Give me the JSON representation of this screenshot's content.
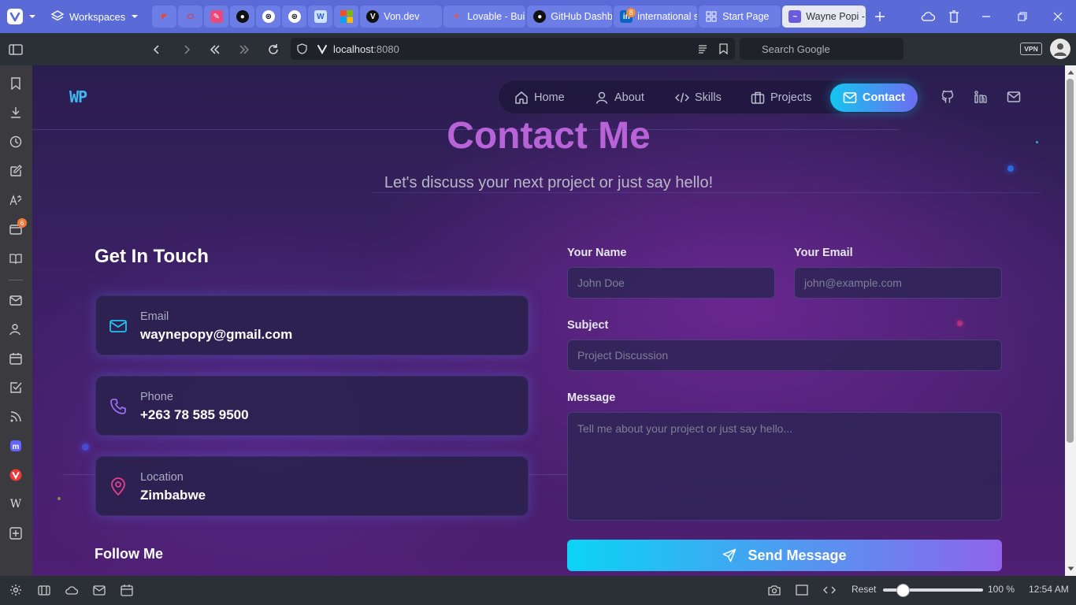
{
  "browser": {
    "workspaces_label": "Workspaces",
    "tabs": [
      {
        "label": "Von.dev"
      },
      {
        "label": "Lovable - Buil"
      },
      {
        "label": "GitHub Dashb"
      },
      {
        "label": "international s",
        "badge": "8"
      },
      {
        "label": "Start Page"
      },
      {
        "label": "Wayne Popi -"
      }
    ],
    "url_host": "localhost",
    "url_port": ":8080",
    "search_placeholder": "Search Google",
    "vpn_label": "VPN",
    "sidepanel_badge": "6",
    "status": {
      "reset_label": "Reset",
      "zoom_label": "100 %",
      "zoom_level": 0.2,
      "clock": "12:54 AM"
    },
    "colors": {
      "tabbar": "#5a6bd8",
      "toolbar": "#2b2f36"
    }
  },
  "site": {
    "logo": "WP",
    "nav": {
      "items": [
        {
          "label": "Home",
          "icon": "home-icon"
        },
        {
          "label": "About",
          "icon": "user-icon"
        },
        {
          "label": "Skills",
          "icon": "code-icon"
        },
        {
          "label": "Projects",
          "icon": "briefcase-icon"
        },
        {
          "label": "Contact",
          "icon": "mail-icon",
          "active": true
        }
      ],
      "social_icons": [
        "github-icon",
        "linkedin-icon",
        "mail-icon"
      ]
    },
    "hero": {
      "title": "Contact Me",
      "subtitle": "Let's discuss your next project or just say hello!"
    },
    "contact": {
      "heading": "Get In Touch",
      "cards": [
        {
          "label": "Email",
          "value": "waynepopy@gmail.com",
          "icon": "mail-icon",
          "color": "#22c3f0"
        },
        {
          "label": "Phone",
          "value": "+263 78 585 9500",
          "icon": "phone-icon",
          "color": "#9a6cf0"
        },
        {
          "label": "Location",
          "value": "Zimbabwe",
          "icon": "map-pin-icon",
          "color": "#e0408f"
        }
      ],
      "follow_heading": "Follow Me"
    },
    "form": {
      "name_label": "Your Name",
      "name_placeholder": "John Doe",
      "email_label": "Your Email",
      "email_placeholder": "john@example.com",
      "subject_label": "Subject",
      "subject_placeholder": "Project Discussion",
      "message_label": "Message",
      "message_placeholder": "Tell me about your project or just say hello...",
      "submit_label": "Send Message"
    },
    "colors": {
      "accent_cyan": "#14c5f0",
      "accent_purple": "#8f64ec",
      "title": "#b864d8"
    }
  }
}
